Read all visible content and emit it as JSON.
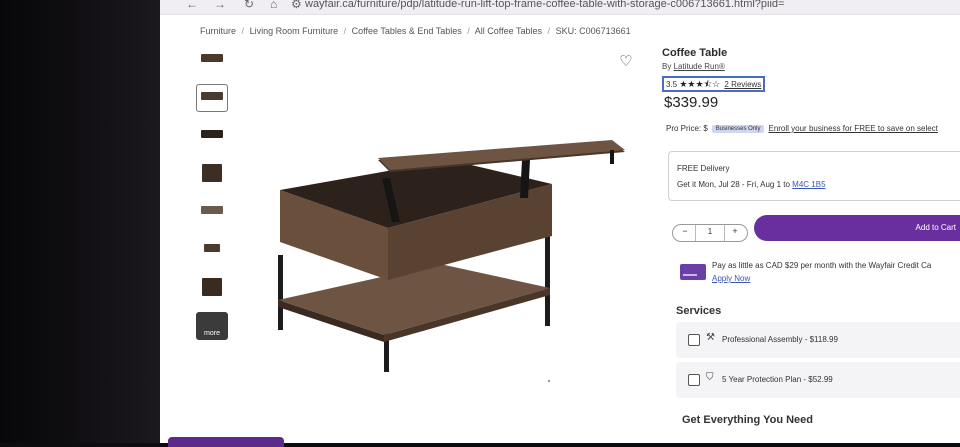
{
  "browser": {
    "url": "wayfair.ca/furniture/pdp/latitude-run-lift-top-frame-coffee-table-with-storage-c006713661.html?piid="
  },
  "breadcrumb": [
    "Furniture",
    "Living Room Furniture",
    "Coffee Tables & End Tables",
    "All Coffee Tables",
    "SKU: C006713661"
  ],
  "breadcrumb_separator": "/",
  "thumbnails": {
    "count": 8,
    "selected_index": 1,
    "more_label": "more"
  },
  "product": {
    "title": "Coffee Table",
    "by_prefix": "By",
    "brand": "Latitude Run®",
    "rating": "3.5",
    "rating_value": 3.5,
    "stars_glyphs": "★★★⯪☆",
    "reviews": "2 Reviews",
    "price": "$339.99"
  },
  "pro_price": {
    "label": "Pro Price: $",
    "badge": "Businesses Only",
    "link": "Enroll your business for FREE to save on select"
  },
  "delivery": {
    "label": "FREE Delivery",
    "date_text": "Get it Mon, Jul 28 - Fri, Aug 1 to",
    "postal": "M4C 1B5"
  },
  "quantity": {
    "minus": "−",
    "value": "1",
    "plus": "+"
  },
  "add_to_cart": "Add to Cart",
  "credit": {
    "text": "Pay as little as CAD $29 per month with the Wayfair Credit Ca",
    "link": "Apply Now"
  },
  "services": {
    "heading": "Services",
    "items": [
      {
        "label": "Professional Assembly - $118.99",
        "icon": "wrench-icon"
      },
      {
        "label": "5 Year Protection Plan - $52.99",
        "icon": "shield-icon"
      }
    ]
  },
  "get_everything": "Get Everything You Need",
  "colors": {
    "brand_purple": "#6a2f9e",
    "link_blue": "#3a55b5",
    "highlight": "#4a6cc4"
  }
}
